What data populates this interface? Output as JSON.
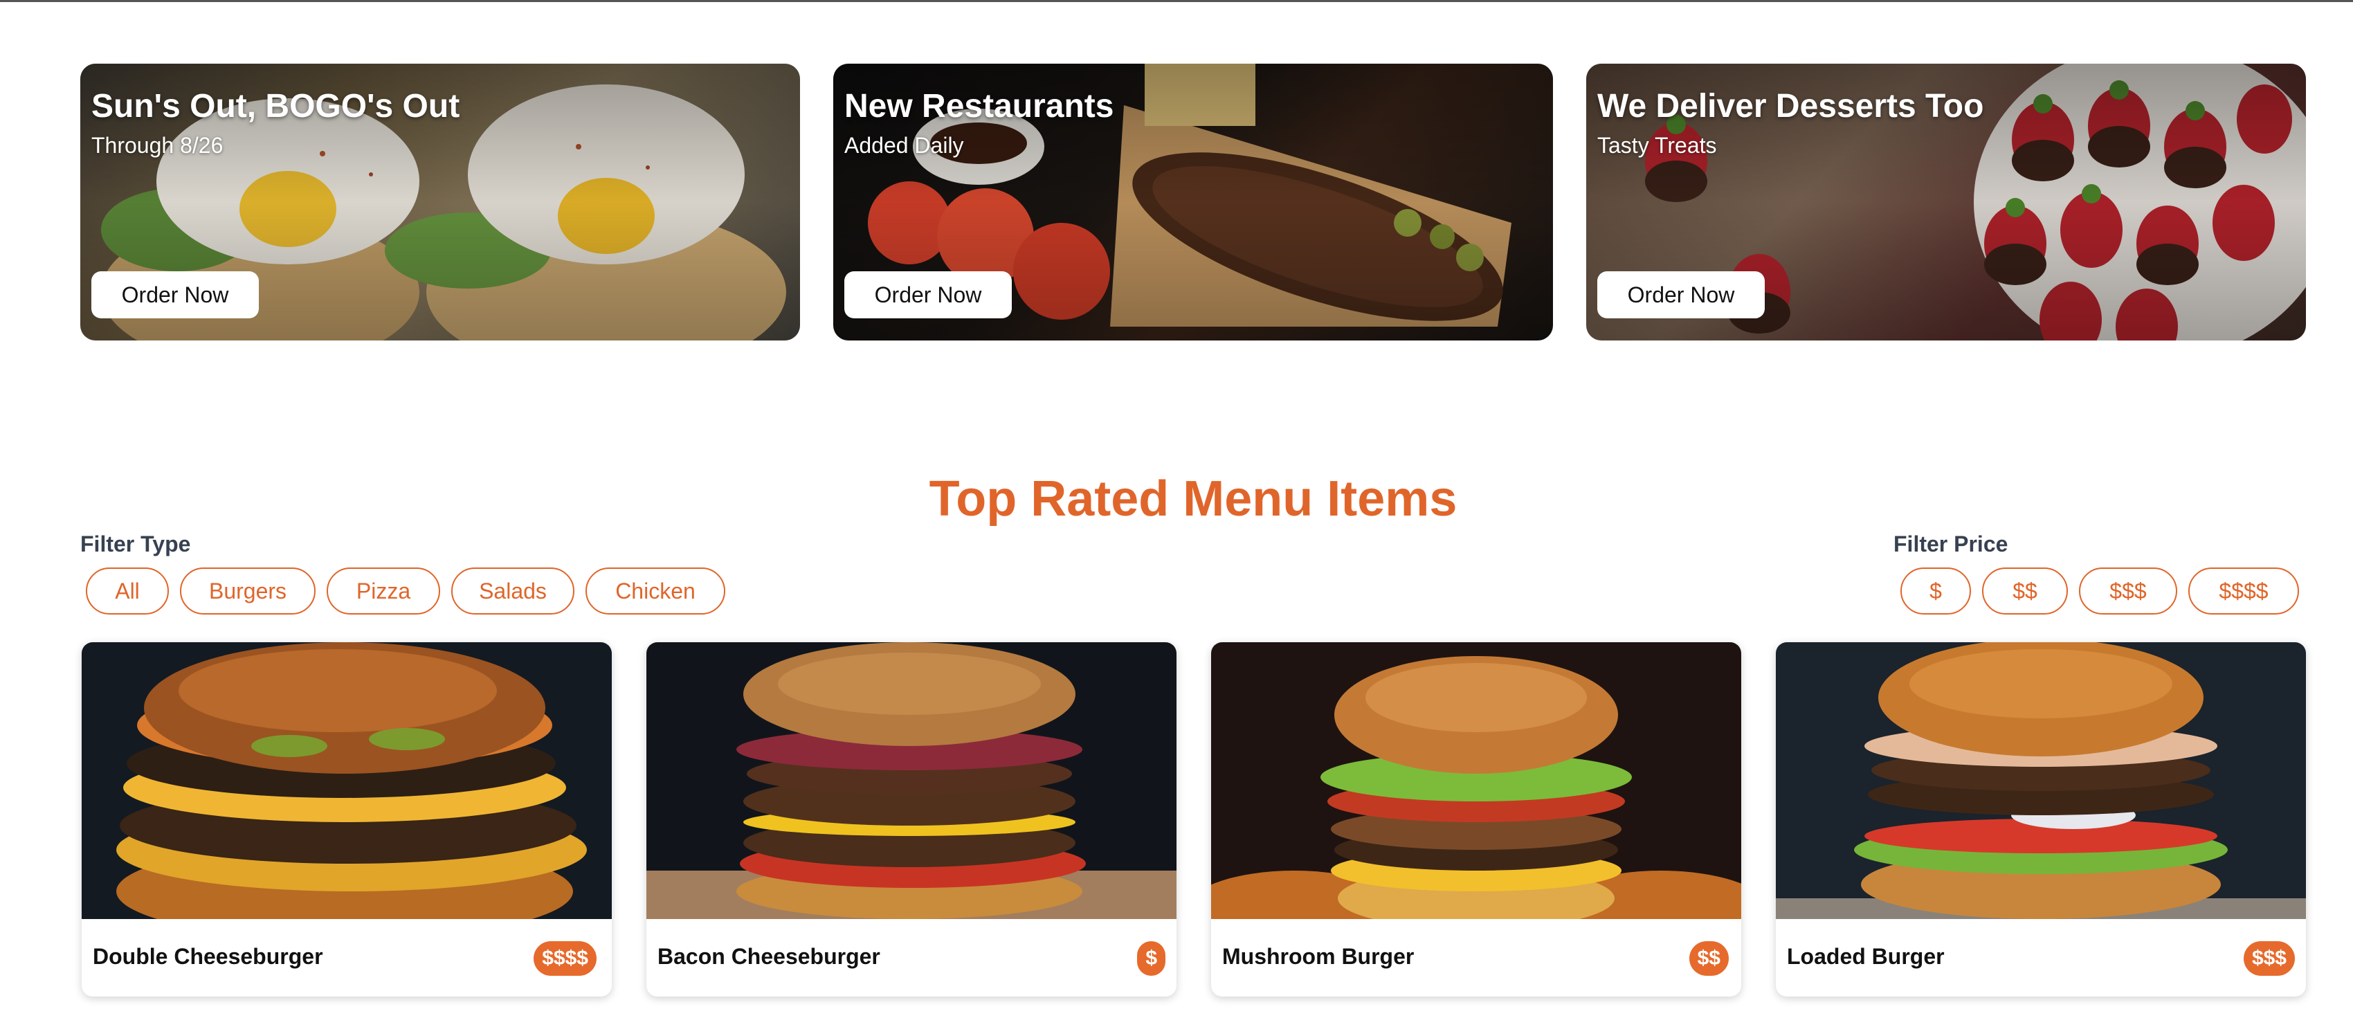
{
  "promos": [
    {
      "title": "Sun's Out, BOGO's Out",
      "subtitle": "Through 8/26",
      "button": "Order Now"
    },
    {
      "title": "New Restaurants",
      "subtitle": "Added Daily",
      "button": "Order Now"
    },
    {
      "title": "We Deliver Desserts Too",
      "subtitle": "Tasty Treats",
      "button": "Order Now"
    }
  ],
  "section_title": "Top Rated Menu Items",
  "filter_type": {
    "label": "Filter Type",
    "options": [
      "All",
      "Burgers",
      "Pizza",
      "Salads",
      "Chicken"
    ]
  },
  "filter_price": {
    "label": "Filter Price",
    "options": [
      "$",
      "$$",
      "$$$",
      "$$$$"
    ]
  },
  "menu_items": [
    {
      "name": "Double Cheeseburger",
      "price": "$$$$"
    },
    {
      "name": "Bacon Cheeseburger",
      "price": "$"
    },
    {
      "name": "Mushroom Burger",
      "price": "$$"
    },
    {
      "name": "Loaded Burger",
      "price": "$$$"
    }
  ],
  "colors": {
    "accent": "#e0652a",
    "price_badge": "#e66a2c",
    "button_bg": "#ffffff"
  }
}
